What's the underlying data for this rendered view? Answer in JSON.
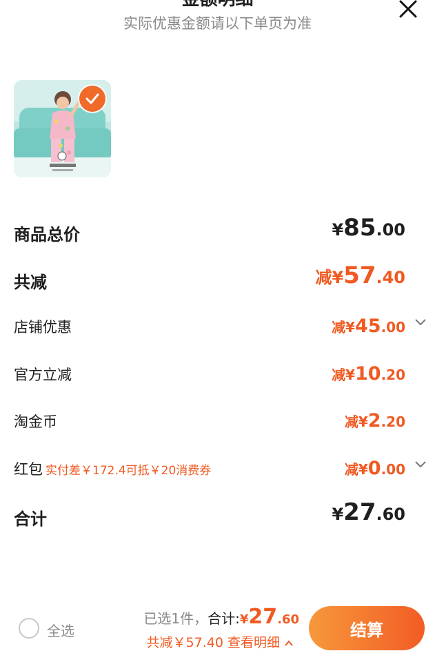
{
  "header": {
    "title": "金额明细",
    "subtitle": "实际优惠金额请以下单页为准"
  },
  "product": {
    "image_icon": "product-thumbnail",
    "selected": true
  },
  "rows": {
    "total_price": {
      "label": "商品总价",
      "prefix": "¥",
      "int": "85",
      "dec": ".00"
    },
    "total_discount": {
      "label": "共减",
      "prefix": "减¥",
      "int": "57",
      "dec": ".40"
    },
    "store_discount": {
      "label": "店铺优惠",
      "prefix": "减¥",
      "int": "45",
      "dec": ".00"
    },
    "official_discount": {
      "label": "官方立减",
      "prefix": "减¥",
      "int": "10",
      "dec": ".20"
    },
    "taojin_coin": {
      "label": "淘金币",
      "prefix": "减¥",
      "int": "2",
      "dec": ".20"
    },
    "red_packet": {
      "label": "红包",
      "hint": "实付差￥172.4可抵￥20消费券",
      "prefix": "减¥",
      "int": "0",
      "dec": ".00"
    },
    "subtotal": {
      "label": "合计",
      "prefix": "¥",
      "int": "27",
      "dec": ".60"
    }
  },
  "bottom_bar": {
    "select_all": "全选",
    "selected_count": "已选1件，",
    "sum_label": "合计:",
    "sum_prefix": "¥",
    "sum_int": "27",
    "sum_dec": ".60",
    "discount_text": "共减￥57.40",
    "detail_link": "查看明细",
    "checkout": "结算"
  },
  "colors": {
    "accent": "#f05a22",
    "button_gradient_start": "#f7983b",
    "button_gradient_end": "#f25c25"
  }
}
